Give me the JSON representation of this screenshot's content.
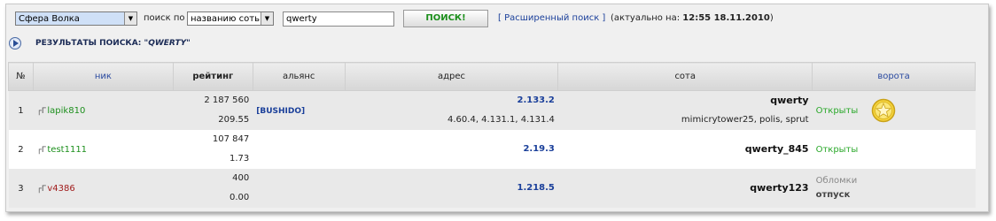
{
  "search": {
    "location_value": "Сфера Волка",
    "search_by_label": "поиск по",
    "search_by_value": "названию соть",
    "query_value": "qwerty",
    "button_label": "ПОИСК!",
    "advanced_link": "[ Расширенный поиск ]",
    "actual_prefix": "(актуально на: ",
    "actual_value": "12:55 18.11.2010",
    "actual_suffix": ")"
  },
  "results": {
    "title_prefix": "РЕЗУЛЬТАТЫ ПОИСКА: ",
    "title_query": "\"QWERTY\""
  },
  "table": {
    "headers": [
      "№",
      "ник",
      "рейтинг",
      "альянс",
      "адрес",
      "сота",
      "ворота"
    ],
    "rows": [
      {
        "num": "1",
        "nick_prefix": "┌Г",
        "nick": "lapik810",
        "rating_top": "2 187 560",
        "rating_bottom": "209.55",
        "alliance": "[BUSHIDO]",
        "addr_top": "2.133.2",
        "addr_bottom": "4.60.4, 4.131.1, 4.131.4",
        "sota_top": "qwerty",
        "sota_bottom": "mimicrytower25, polis, sprut",
        "gate": "Открыты"
      },
      {
        "num": "2",
        "nick_prefix": "┌Г",
        "nick": "test1111",
        "rating_top": "107 847",
        "rating_bottom": "1.73",
        "alliance": "",
        "addr_top": "2.19.3",
        "addr_bottom": "",
        "sota_top": "qwerty_845",
        "sota_bottom": "",
        "gate": "Открыты"
      },
      {
        "num": "3",
        "nick_prefix": "┌Г",
        "nick": "v4386",
        "rating_top": "400",
        "rating_bottom": "0.00",
        "alliance": "",
        "addr_top": "1.218.5",
        "addr_bottom": "",
        "sota_top": "qwerty123",
        "sota_bottom": "",
        "gate": "Обломки",
        "gate_extra": "отпуск"
      }
    ]
  },
  "colors": {
    "accent_link": "#1a3f9a",
    "open": "#2aa82a",
    "nick_green": "#1c8f1c",
    "nick_red": "#a11c1c"
  }
}
